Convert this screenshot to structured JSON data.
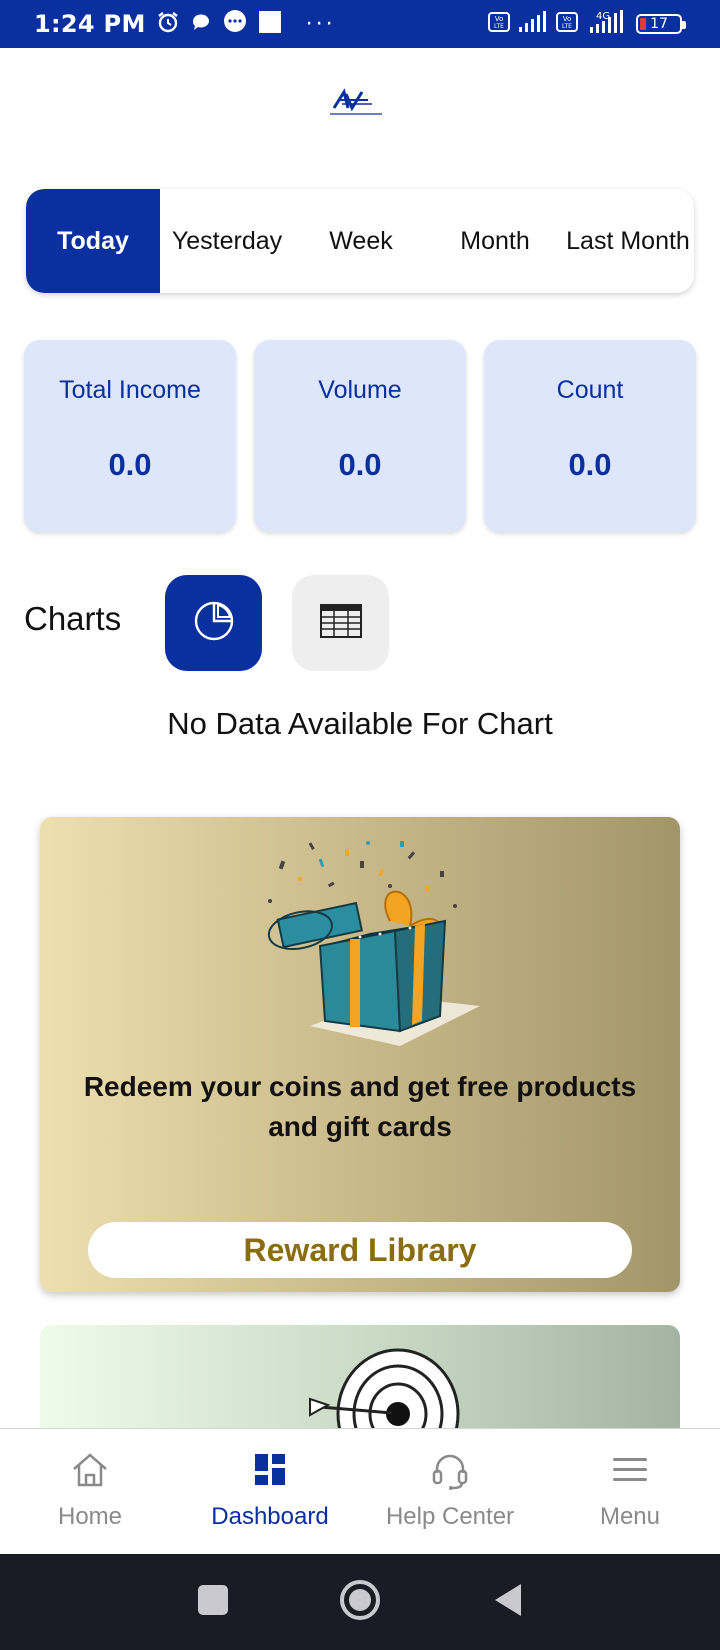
{
  "status_bar": {
    "time": "1:24 PM",
    "battery": "17",
    "network": "4G",
    "icons": [
      "alarm-icon",
      "chat-bubble-icon",
      "message-icon",
      "square-notification-icon",
      "more-dots-icon",
      "volte-icon",
      "signal-icon",
      "battery-icon"
    ]
  },
  "tabs": [
    {
      "label": "Today",
      "active": true
    },
    {
      "label": "Yesterday",
      "active": false
    },
    {
      "label": "Week",
      "active": false
    },
    {
      "label": "Month",
      "active": false
    },
    {
      "label": "Last Month",
      "active": false
    }
  ],
  "stats": [
    {
      "label": "Total Income",
      "value": "0.0"
    },
    {
      "label": "Volume",
      "value": "0.0"
    },
    {
      "label": "Count",
      "value": "0.0"
    }
  ],
  "charts": {
    "title": "Charts",
    "pie_view_icon": "pie-chart-icon",
    "table_view_icon": "table-icon",
    "empty_message": "No Data Available For Chart"
  },
  "reward_banner": {
    "text": "Redeem your coins and get free products and gift cards",
    "button_label": "Reward Library",
    "image": "gift-box-illustration"
  },
  "second_banner": {
    "image": "target-dart-illustration"
  },
  "bottom_nav": [
    {
      "label": "Home",
      "icon": "home-icon",
      "active": false
    },
    {
      "label": "Dashboard",
      "icon": "dashboard-icon",
      "active": true
    },
    {
      "label": "Help Center",
      "icon": "headset-icon",
      "active": false
    },
    {
      "label": "Menu",
      "icon": "hamburger-icon",
      "active": false
    }
  ],
  "colors": {
    "primary": "#0a2f9e",
    "card_bg": "#dde6fb",
    "reward_text": "#8a6d10",
    "inactive_nav": "#8a8a8a"
  }
}
